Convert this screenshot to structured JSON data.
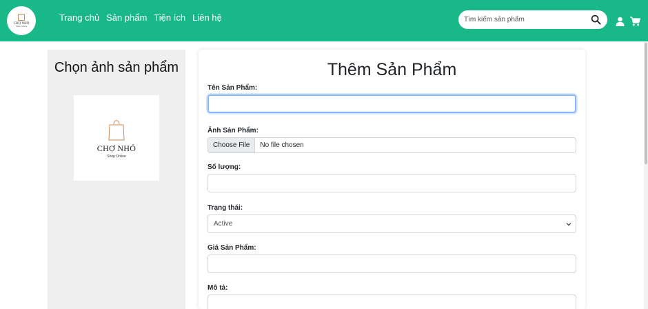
{
  "header": {
    "logo": {
      "text": "CHỢ NHỎ",
      "sub": "Shop Online"
    },
    "nav": [
      "Trang chủ",
      "Sản phẩm",
      "Tiện ích",
      "Liên hệ"
    ],
    "search_placeholder": "Tìm kiếm sản phẩm",
    "icons": [
      "search-icon",
      "user-icon",
      "cart-icon"
    ]
  },
  "left": {
    "title": "Chọn ảnh sản phẩm",
    "preview": {
      "brand": "CHỢ NHỎ",
      "sub": "Shop Online"
    }
  },
  "form": {
    "title": "Thêm Sản Phẩm",
    "name_label": "Tên Sản Phẩm:",
    "name_value": "",
    "image_label": "Ảnh Sản Phẩm:",
    "choose_file": "Choose File",
    "no_file": "No file chosen",
    "qty_label": "Số lượng:",
    "qty_value": "",
    "status_label": "Trạng thái:",
    "status_value": "Active",
    "price_label": "Giá Sản Phẩm:",
    "price_value": "",
    "desc_label": "Mô tả:",
    "desc_value": ""
  },
  "colors": {
    "header": "#18b889",
    "left_panel": "#efefef",
    "focus": "#86b7fe"
  }
}
